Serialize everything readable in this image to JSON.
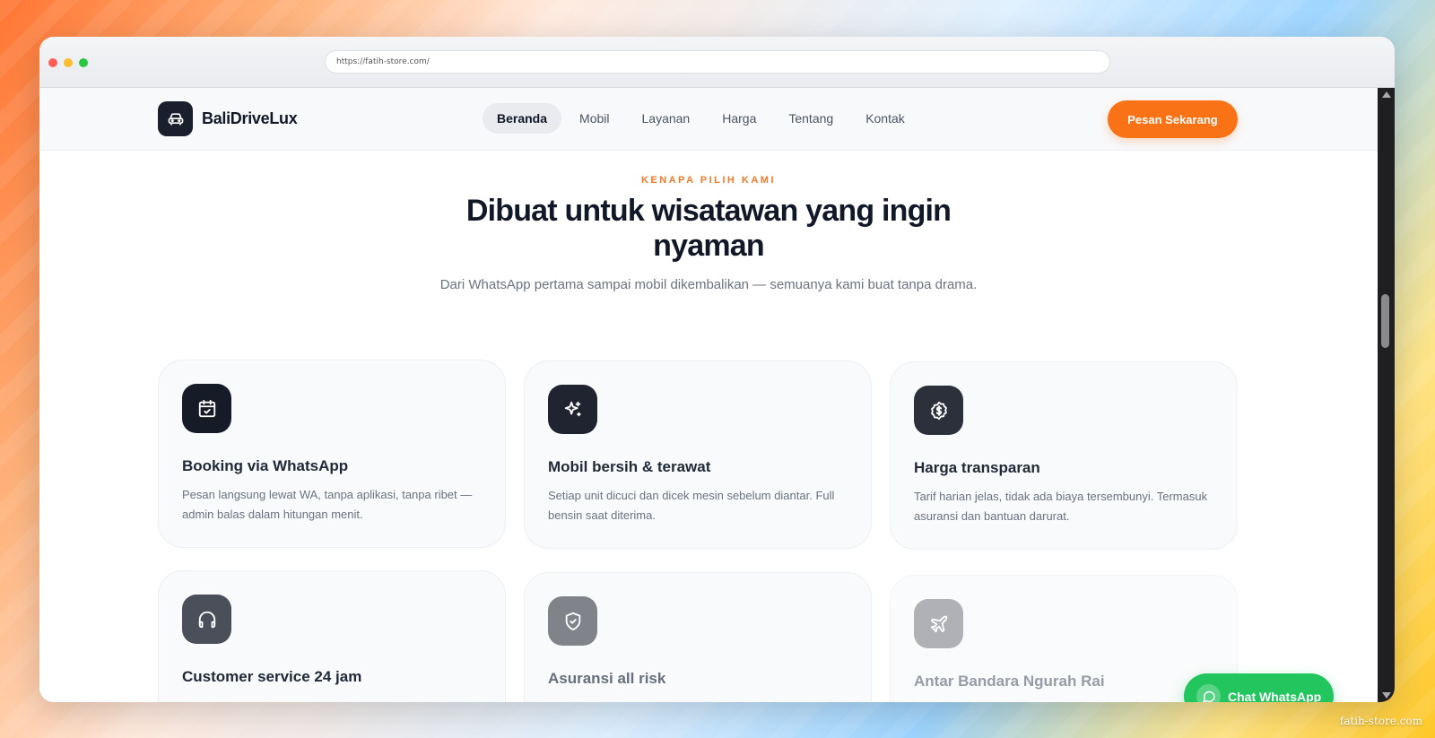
{
  "browser": {
    "url": "https://fatih-store.com/"
  },
  "nav": {
    "brand": "BaliDriveLux",
    "links": [
      "Beranda",
      "Mobil",
      "Layanan",
      "Harga",
      "Tentang",
      "Kontak"
    ],
    "active": "Beranda",
    "cta": "Pesan Sekarang"
  },
  "section": {
    "eyebrow": "KENAPA PILIH KAMI",
    "heading": "Dibuat untuk wisatawan yang ingin nyaman",
    "subtitle": "Dari WhatsApp pertama sampai mobil dikembalikan — semuanya kami buat tanpa drama."
  },
  "cards": [
    {
      "icon": "calendar-check-icon",
      "title": "Booking via WhatsApp",
      "desc": "Pesan langsung lewat WA, tanpa aplikasi, tanpa ribet — admin balas dalam hitungan menit."
    },
    {
      "icon": "sparkles-icon",
      "title": "Mobil bersih & terawat",
      "desc": "Setiap unit dicuci dan dicek mesin sebelum diantar. Full bensin saat diterima."
    },
    {
      "icon": "dollar-badge-icon",
      "title": "Harga transparan",
      "desc": "Tarif harian jelas, tidak ada biaya tersembunyi. Termasuk asuransi dan bantuan darurat."
    },
    {
      "icon": "headphones-icon",
      "title": "Customer service 24 jam",
      "desc": ""
    },
    {
      "icon": "shield-check-icon",
      "title": "Asuransi all risk",
      "desc": ""
    },
    {
      "icon": "plane-icon",
      "title": "Antar Bandara Ngurah Rai",
      "desc": ""
    }
  ],
  "whatsapp": {
    "label": "Chat WhatsApp"
  },
  "watermark": "fatih-store.com",
  "colors": {
    "accent": "#f97316",
    "dark": "#1a1f2e",
    "whatsapp": "#22c55e",
    "eyebrow": "#f07a2a"
  }
}
